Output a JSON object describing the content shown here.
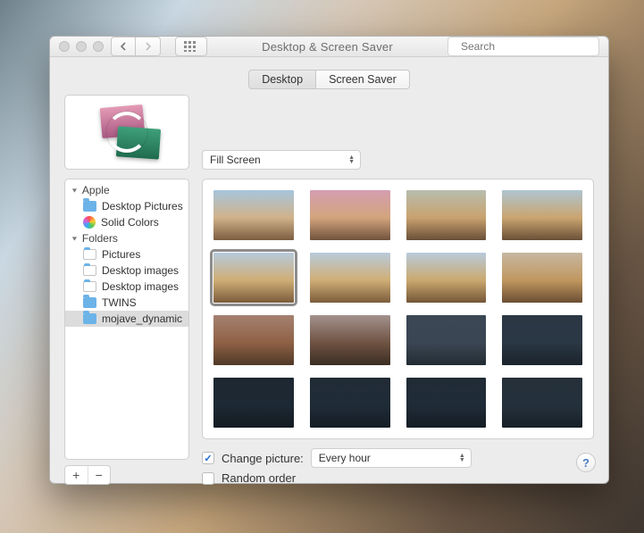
{
  "window": {
    "title": "Desktop & Screen Saver",
    "search_placeholder": "Search"
  },
  "tabs": {
    "desktop": "Desktop",
    "screensaver": "Screen Saver",
    "active": "desktop"
  },
  "fill_mode": {
    "value": "Fill Screen"
  },
  "sidebar": {
    "group1_label": "Apple",
    "group1": [
      {
        "label": "Desktop Pictures",
        "icon": "folder-blue"
      },
      {
        "label": "Solid Colors",
        "icon": "color-swatch"
      }
    ],
    "group2_label": "Folders",
    "group2": [
      {
        "label": "Pictures",
        "icon": "folder-empty"
      },
      {
        "label": "Desktop images",
        "icon": "folder-empty"
      },
      {
        "label": "Desktop images",
        "icon": "folder-empty"
      },
      {
        "label": "TWINS",
        "icon": "folder-blue"
      },
      {
        "label": "mojave_dynamic",
        "icon": "folder-blue",
        "selected": true
      }
    ],
    "add_label": "+",
    "remove_label": "−"
  },
  "thumbnails": {
    "count": 16,
    "selected_index": 4
  },
  "options": {
    "change_picture_checked": true,
    "change_picture_label": "Change picture:",
    "interval_value": "Every hour",
    "random_checked": false,
    "random_label": "Random order"
  },
  "help_label": "?"
}
